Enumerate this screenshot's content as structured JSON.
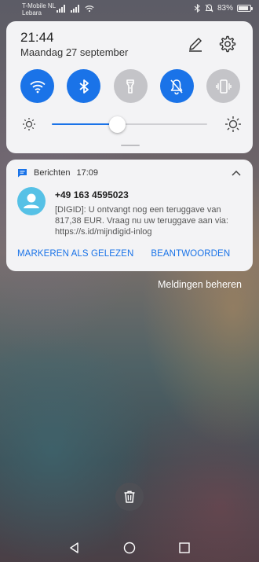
{
  "statusbar": {
    "carrier_line1": "T-Mobile NL",
    "carrier_line2": "Lebara",
    "battery_text": "83%",
    "battery_level": 0.83,
    "icons": [
      "signal-icon",
      "signal-icon",
      "wifi-icon",
      "bluetooth-icon",
      "mute-icon",
      "battery-icon"
    ]
  },
  "quick_settings": {
    "time": "21:44",
    "date": "Maandag 27 september",
    "toggles": [
      {
        "name": "wifi",
        "icon": "wifi-icon",
        "state": "on"
      },
      {
        "name": "bluetooth",
        "icon": "bluetooth-icon",
        "state": "on"
      },
      {
        "name": "flashlight",
        "icon": "flashlight-icon",
        "state": "off"
      },
      {
        "name": "silent",
        "icon": "bell-off-icon",
        "state": "on"
      },
      {
        "name": "vibrate",
        "icon": "vibrate-icon",
        "state": "off"
      }
    ],
    "brightness_level": 0.42,
    "accent_color": "#1a73e8"
  },
  "notification": {
    "app_name": "Berichten",
    "time": "17:09",
    "sender": "+49 163 4595023",
    "message": "[DIGID]: U ontvangt nog een teruggave van 817,38 EUR. Vraag nu uw teruggave aan via: https://s.id/mijndigid-inlog",
    "action_mark_read": "MARKEREN ALS GELEZEN",
    "action_reply": "BEANTWOORDEN"
  },
  "manage_notifications": "Meldingen beheren"
}
